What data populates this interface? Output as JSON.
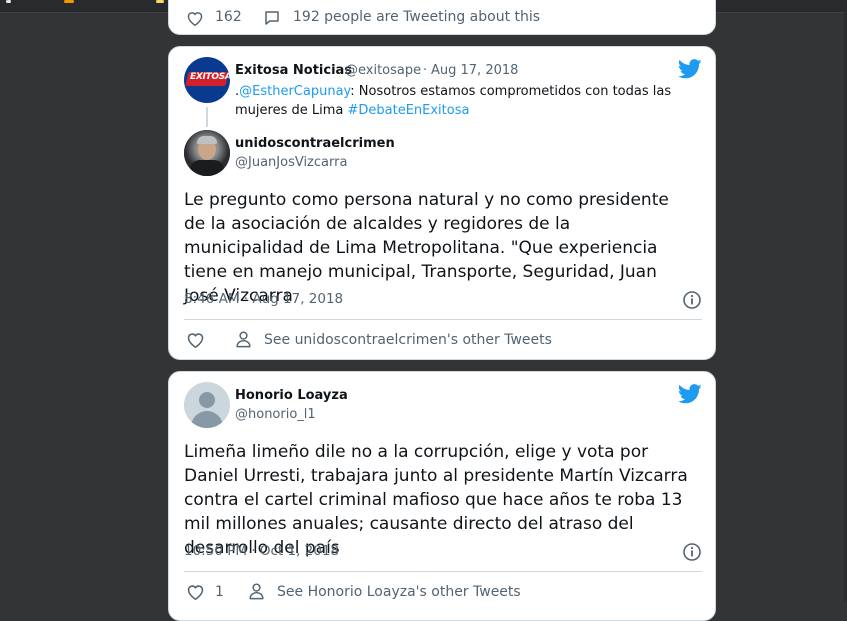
{
  "colors": {
    "background": "#333436",
    "card": "#ffffff",
    "accent": "#1d9bf0",
    "text": "#0f1419",
    "muted": "#536471"
  },
  "top_card": {
    "likes": "162",
    "people_text": "192 people are Tweeting about this"
  },
  "tweet1": {
    "quoted": {
      "name": "Exitosa Noticias",
      "handle": "@exitosape",
      "separator": "·",
      "date": "Aug 17, 2018",
      "text_prefix": ".",
      "mention": "@EstherCapunay",
      "text_middle": ": Nosotros estamos comprometidos con todas las mujeres de Lima ",
      "hashtag": "#DebateEnExitosa",
      "avatar_label": "EXITOSA"
    },
    "author": {
      "name": "unidoscontraelcrimen",
      "handle": "@JuanJosVizcarra"
    },
    "text": "Le pregunto como persona natural y no como presidente de la asociación de alcaldes y regidores de la municipalidad de Lima Metropolitana. \"Que experiencia tiene en manejo municipal, Transporte, Seguridad, Juan José Vizcarra",
    "timestamp": "8:46 AM · Aug 17, 2018",
    "see_other": "See unidoscontraelcrimen's other Tweets",
    "icons": [
      "heart-icon",
      "person-icon",
      "info-icon",
      "twitter-bird-icon"
    ]
  },
  "tweet2": {
    "author": {
      "name": "Honorio Loayza",
      "handle": "@honorio_l1"
    },
    "text": "Limeña limeño dile no a la corrupción, elige y vota por Daniel Urresti, trabajara junto al presidente Martín Vizcarra contra el cartel criminal mafioso que hace años  te roba 13 mil millones anuales; causante directo del atraso del desarrollo del país",
    "timestamp": "10:50 PM · Oct 1, 2018",
    "likes": "1",
    "see_other": "See Honorio Loayza's other Tweets"
  }
}
